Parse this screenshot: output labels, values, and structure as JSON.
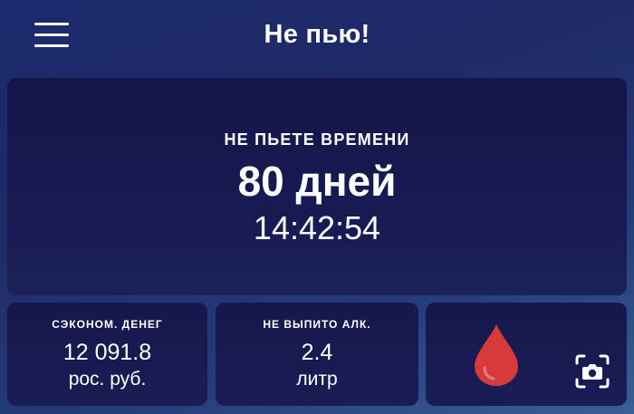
{
  "header": {
    "title": "Не пью!"
  },
  "main": {
    "label": "НЕ ПЬЕТЕ ВРЕМЕНИ",
    "days": "80 дней",
    "clock": "14:42:54"
  },
  "stats": {
    "money": {
      "label": "СЭКОНОМ. ДЕНЕГ",
      "value": "12 091.8",
      "unit": "рос. руб."
    },
    "alcohol": {
      "label": "НЕ ВЫПИТО АЛК.",
      "value": "2.4",
      "unit": "литр"
    }
  },
  "icons": {
    "menu": "hamburger-menu-icon",
    "drop": "blood-drop-icon",
    "camera": "camera-capture-icon"
  },
  "colors": {
    "drop": "#d63a3a",
    "card": "#16174c",
    "background": "#1f2a66"
  }
}
